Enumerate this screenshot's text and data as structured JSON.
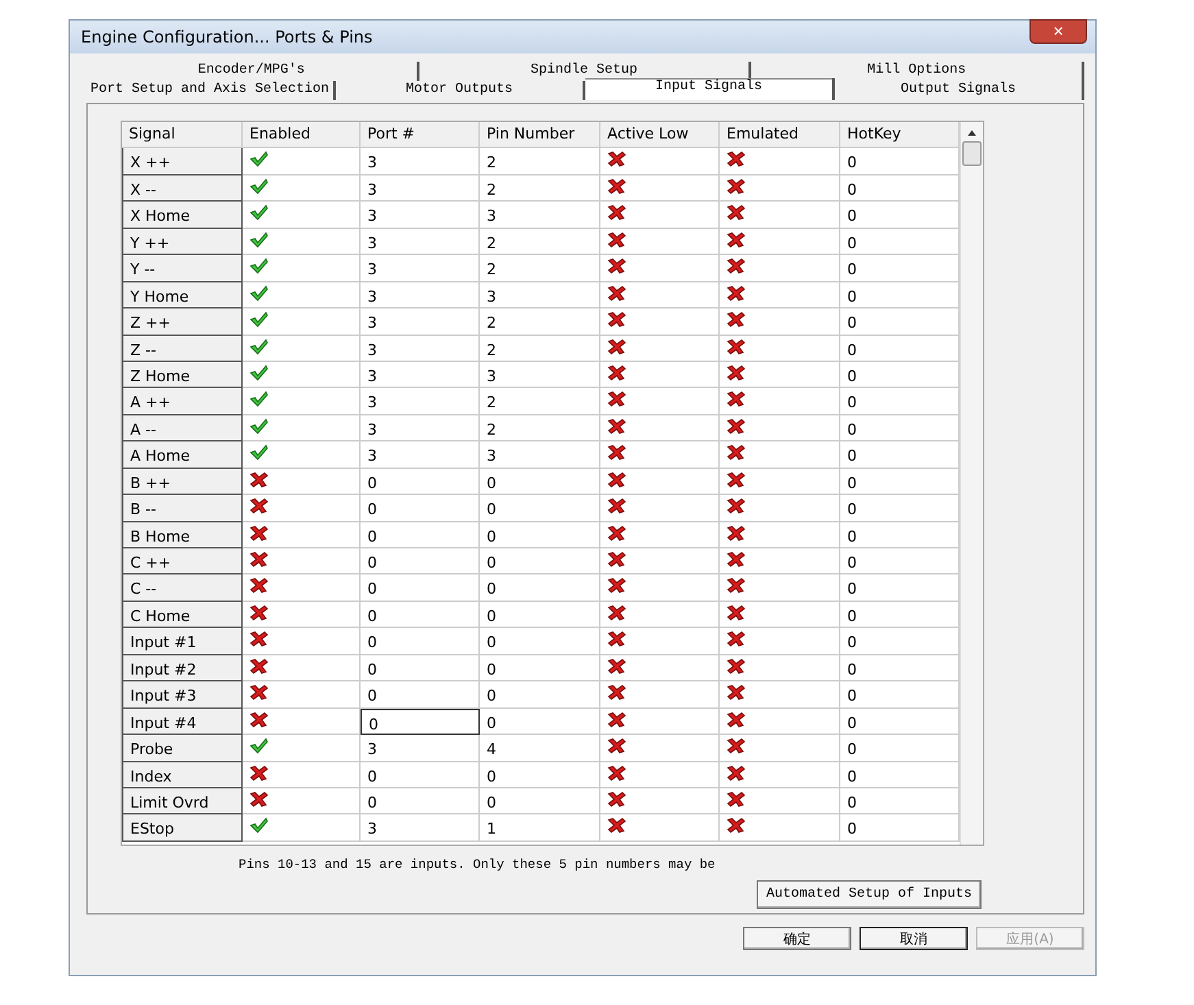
{
  "window": {
    "title": "Engine Configuration... Ports & Pins",
    "close": "×"
  },
  "tab_rows": [
    [
      {
        "label": "Encoder/MPG's",
        "selected": false
      },
      {
        "label": "Spindle Setup",
        "selected": false
      },
      {
        "label": "Mill Options",
        "selected": false
      }
    ],
    [
      {
        "label": "Port Setup and Axis Selection",
        "selected": false
      },
      {
        "label": "Motor Outputs",
        "selected": false
      },
      {
        "label": "Input Signals",
        "selected": true
      },
      {
        "label": "Output Signals",
        "selected": false
      }
    ]
  ],
  "table": {
    "columns": [
      "Signal",
      "Enabled",
      "Port #",
      "Pin Number",
      "Active Low",
      "Emulated",
      "HotKey"
    ],
    "rows": [
      {
        "signal": "X ++",
        "enabled": true,
        "port": "3",
        "pin": "2",
        "active_low": false,
        "emulated": false,
        "hotkey": "0",
        "port_focused": false
      },
      {
        "signal": "X --",
        "enabled": true,
        "port": "3",
        "pin": "2",
        "active_low": false,
        "emulated": false,
        "hotkey": "0",
        "port_focused": false
      },
      {
        "signal": "X Home",
        "enabled": true,
        "port": "3",
        "pin": "3",
        "active_low": false,
        "emulated": false,
        "hotkey": "0",
        "port_focused": false
      },
      {
        "signal": "Y ++",
        "enabled": true,
        "port": "3",
        "pin": "2",
        "active_low": false,
        "emulated": false,
        "hotkey": "0",
        "port_focused": false
      },
      {
        "signal": "Y --",
        "enabled": true,
        "port": "3",
        "pin": "2",
        "active_low": false,
        "emulated": false,
        "hotkey": "0",
        "port_focused": false
      },
      {
        "signal": "Y Home",
        "enabled": true,
        "port": "3",
        "pin": "3",
        "active_low": false,
        "emulated": false,
        "hotkey": "0",
        "port_focused": false
      },
      {
        "signal": "Z ++",
        "enabled": true,
        "port": "3",
        "pin": "2",
        "active_low": false,
        "emulated": false,
        "hotkey": "0",
        "port_focused": false
      },
      {
        "signal": "Z --",
        "enabled": true,
        "port": "3",
        "pin": "2",
        "active_low": false,
        "emulated": false,
        "hotkey": "0",
        "port_focused": false
      },
      {
        "signal": "Z Home",
        "enabled": true,
        "port": "3",
        "pin": "3",
        "active_low": false,
        "emulated": false,
        "hotkey": "0",
        "port_focused": false
      },
      {
        "signal": "A ++",
        "enabled": true,
        "port": "3",
        "pin": "2",
        "active_low": false,
        "emulated": false,
        "hotkey": "0",
        "port_focused": false
      },
      {
        "signal": "A --",
        "enabled": true,
        "port": "3",
        "pin": "2",
        "active_low": false,
        "emulated": false,
        "hotkey": "0",
        "port_focused": false
      },
      {
        "signal": "A Home",
        "enabled": true,
        "port": "3",
        "pin": "3",
        "active_low": false,
        "emulated": false,
        "hotkey": "0",
        "port_focused": false
      },
      {
        "signal": "B ++",
        "enabled": false,
        "port": "0",
        "pin": "0",
        "active_low": false,
        "emulated": false,
        "hotkey": "0",
        "port_focused": false
      },
      {
        "signal": "B --",
        "enabled": false,
        "port": "0",
        "pin": "0",
        "active_low": false,
        "emulated": false,
        "hotkey": "0",
        "port_focused": false
      },
      {
        "signal": "B Home",
        "enabled": false,
        "port": "0",
        "pin": "0",
        "active_low": false,
        "emulated": false,
        "hotkey": "0",
        "port_focused": false
      },
      {
        "signal": "C ++",
        "enabled": false,
        "port": "0",
        "pin": "0",
        "active_low": false,
        "emulated": false,
        "hotkey": "0",
        "port_focused": false
      },
      {
        "signal": "C --",
        "enabled": false,
        "port": "0",
        "pin": "0",
        "active_low": false,
        "emulated": false,
        "hotkey": "0",
        "port_focused": false
      },
      {
        "signal": "C Home",
        "enabled": false,
        "port": "0",
        "pin": "0",
        "active_low": false,
        "emulated": false,
        "hotkey": "0",
        "port_focused": false
      },
      {
        "signal": "Input #1",
        "enabled": false,
        "port": "0",
        "pin": "0",
        "active_low": false,
        "emulated": false,
        "hotkey": "0",
        "port_focused": false
      },
      {
        "signal": "Input #2",
        "enabled": false,
        "port": "0",
        "pin": "0",
        "active_low": false,
        "emulated": false,
        "hotkey": "0",
        "port_focused": false
      },
      {
        "signal": "Input #3",
        "enabled": false,
        "port": "0",
        "pin": "0",
        "active_low": false,
        "emulated": false,
        "hotkey": "0",
        "port_focused": false
      },
      {
        "signal": "Input #4",
        "enabled": false,
        "port": "0",
        "pin": "0",
        "active_low": false,
        "emulated": false,
        "hotkey": "0",
        "port_focused": true
      },
      {
        "signal": "Probe",
        "enabled": true,
        "port": "3",
        "pin": "4",
        "active_low": false,
        "emulated": false,
        "hotkey": "0",
        "port_focused": false
      },
      {
        "signal": "Index",
        "enabled": false,
        "port": "0",
        "pin": "0",
        "active_low": false,
        "emulated": false,
        "hotkey": "0",
        "port_focused": false
      },
      {
        "signal": "Limit Ovrd",
        "enabled": false,
        "port": "0",
        "pin": "0",
        "active_low": false,
        "emulated": false,
        "hotkey": "0",
        "port_focused": false
      },
      {
        "signal": "EStop",
        "enabled": true,
        "port": "3",
        "pin": "1",
        "active_low": false,
        "emulated": false,
        "hotkey": "0",
        "port_focused": false
      }
    ]
  },
  "note": "Pins 10-13 and 15 are inputs. Only these 5 pin numbers may be",
  "automated_button": "Automated Setup of Inputs",
  "buttons": [
    {
      "label": "确定",
      "disabled": false,
      "focused": false
    },
    {
      "label": "取消",
      "disabled": false,
      "focused": true
    },
    {
      "label": "应用(A)",
      "disabled": true,
      "focused": false
    }
  ]
}
